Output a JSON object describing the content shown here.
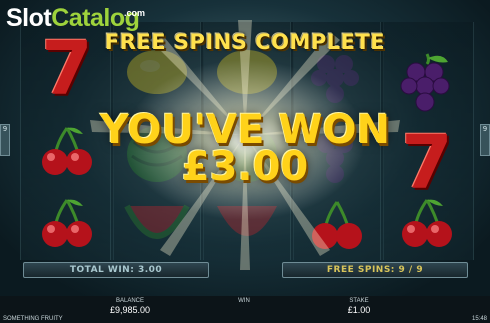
{
  "watermark": {
    "name_part1": "Slot",
    "name_part2": "Catalog",
    "suffix": ".com"
  },
  "banner": {
    "title": "FREE SPINS COMPLETE"
  },
  "win": {
    "headline": "YOU'VE WON",
    "amount": "£3.00"
  },
  "reels": {
    "symbols": [
      [
        "seven",
        "cherry",
        "cherry"
      ],
      [
        "lemon",
        "watermelon",
        "watermelon"
      ],
      [
        "lemon",
        "watermelon",
        "watermelon"
      ],
      [
        "grapes",
        "grapes",
        "cherry"
      ],
      [
        "grapes",
        "seven",
        "cherry"
      ]
    ]
  },
  "bars": {
    "total_win": "TOTAL WIN: 3.00",
    "free_spins": "FREE SPINS: 9 / 9"
  },
  "side_tabs": {
    "left": "9",
    "right": "9"
  },
  "status_bar": {
    "balance_label": "BALANCE",
    "balance_value": "£9,985.00",
    "win_label": "WIN",
    "win_value": "",
    "stake_label": "STAKE",
    "stake_value": "£1.00",
    "game_name": "SOMETHING FRUITY",
    "time": "15:48"
  },
  "colors": {
    "gold": "#ffd21a",
    "logo_green": "#9ed33c",
    "seven_red": "#c61d1d"
  },
  "icons": {
    "seven": "seven-icon",
    "cherry": "cherry-icon",
    "lemon": "lemon-icon",
    "watermelon": "watermelon-icon",
    "grapes": "grapes-icon"
  }
}
